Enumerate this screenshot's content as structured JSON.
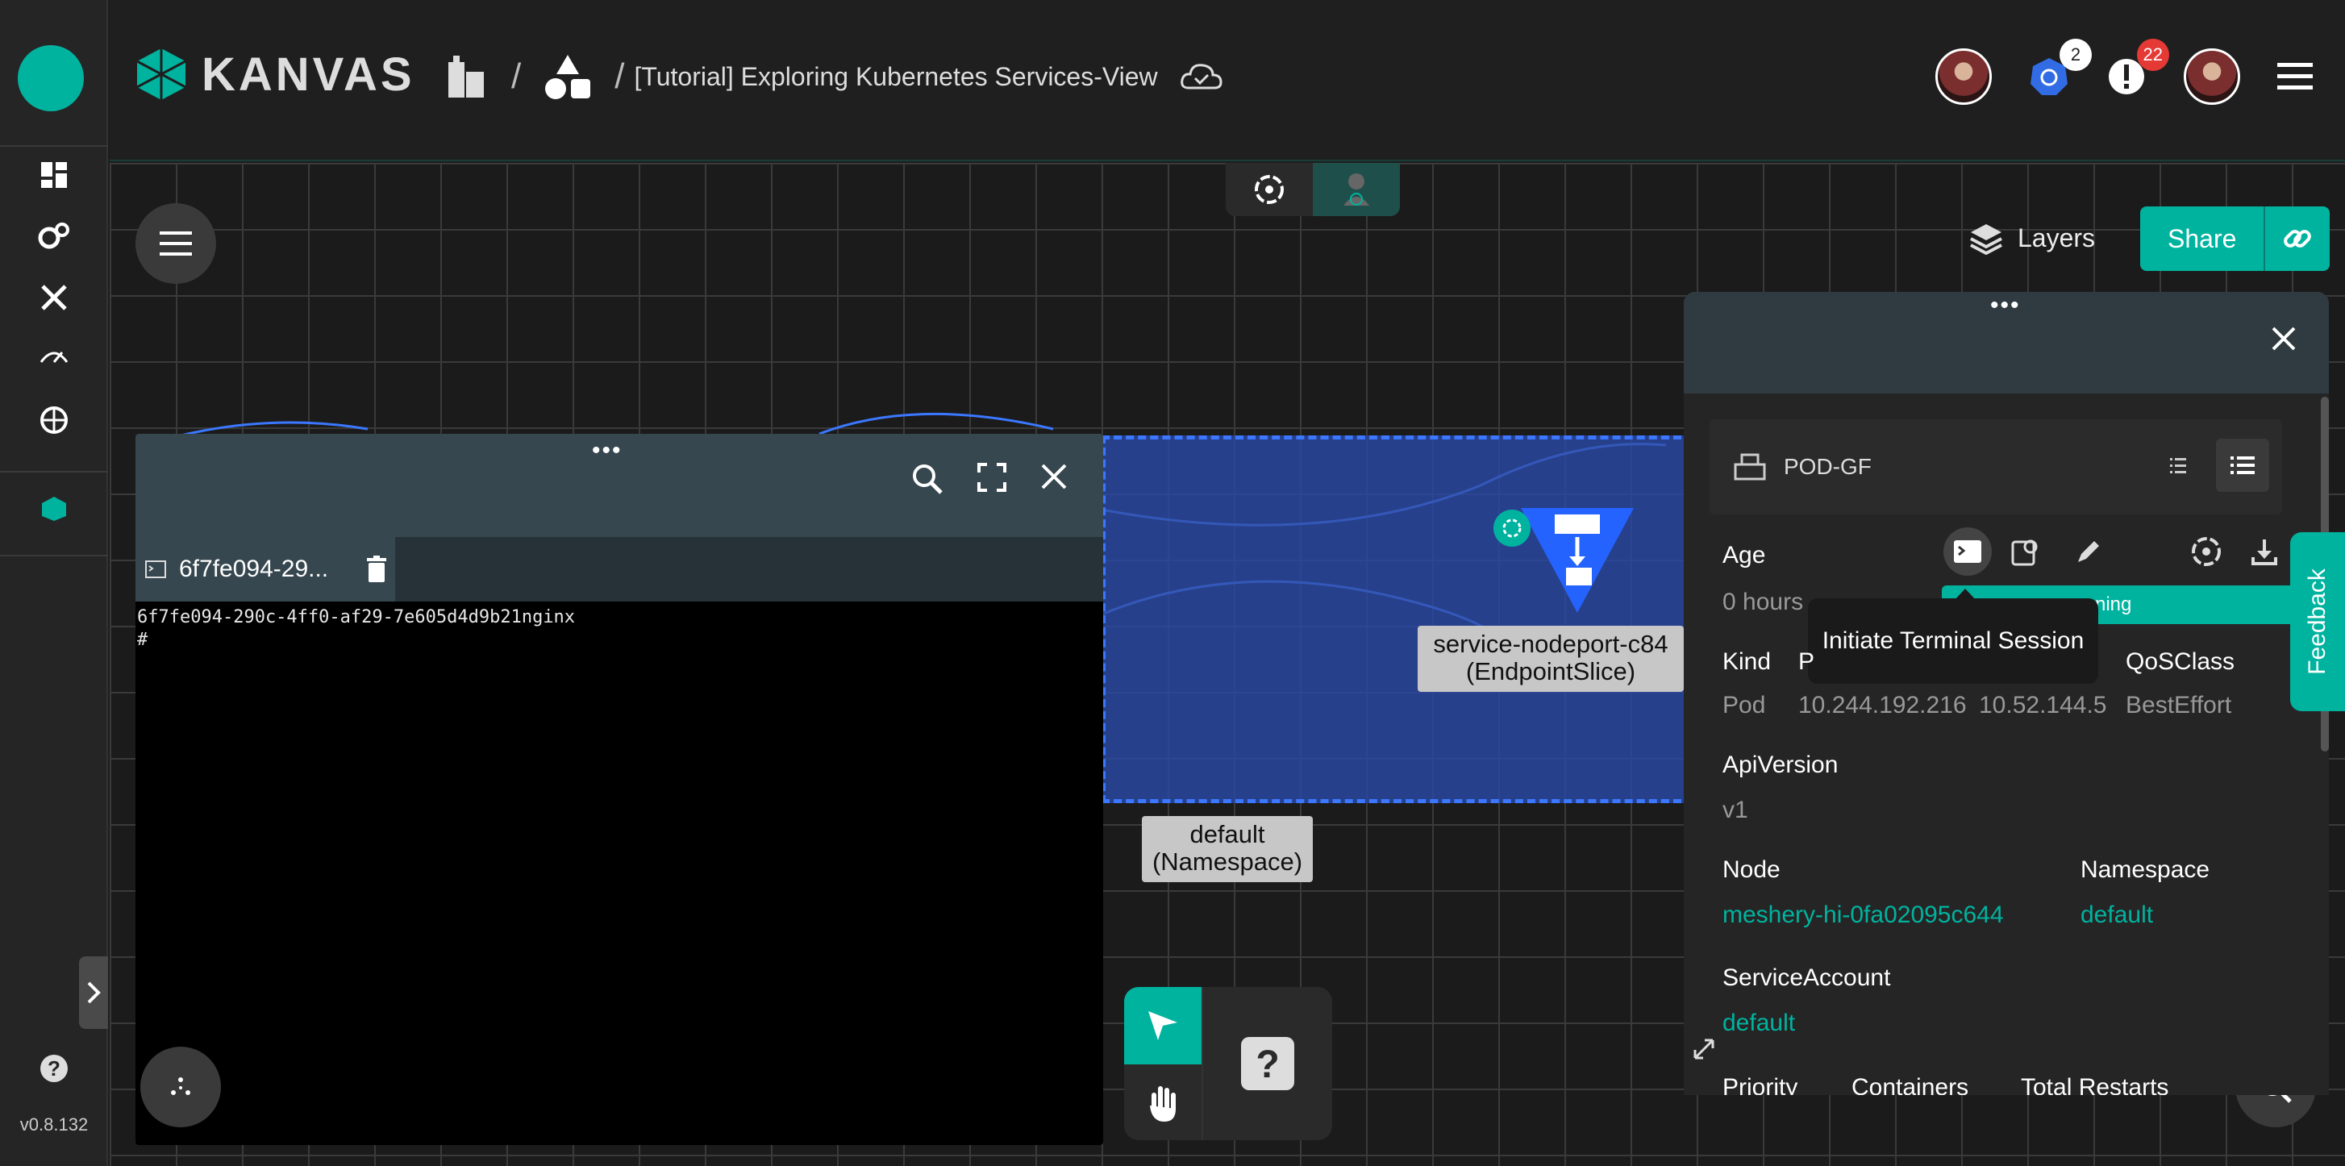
{
  "app": {
    "brand": "KANVAS",
    "version": "v0.8.132"
  },
  "header": {
    "breadcrumb_sep": "/",
    "design_title": "[Tutorial] Exploring Kubernetes Services-View",
    "k8s_badge": "2",
    "alerts_badge": "22"
  },
  "canvas": {
    "layers_label": "Layers",
    "share_label": "Share",
    "node_label_line1": "service-nodeport-c84",
    "node_label_line2": "(EndpointSlice)",
    "namespace_label_line1": "default",
    "namespace_label_line2": "(Namespace)"
  },
  "terminal": {
    "tab_label": "6f7fe094-29...",
    "line1": "6f7fe094-290c-4ff0-af29-7e605d4d9b21nginx",
    "line2": "#"
  },
  "details": {
    "resource_name": "POD-GF",
    "tooltip": "Initiate Terminal Session",
    "status_text": "ning",
    "age_label": "Age",
    "age_value": "0 hours",
    "kind_label": "Kind",
    "p_label": "P",
    "qos_label": "QoSClass",
    "kind_value": "Pod",
    "ip1": "10.244.192.216",
    "ip2": "10.52.144.5",
    "qos_value": "BestEffort",
    "apiversion_label": "ApiVersion",
    "apiversion_value": "v1",
    "node_label": "Node",
    "node_value": "meshery-hi-0fa02095c644",
    "namespace_label": "Namespace",
    "namespace_value": "default",
    "sa_label": "ServiceAccount",
    "sa_value": "default",
    "priority_label": "Priority",
    "containers_label": "Containers",
    "restarts_label": "Total Restarts"
  },
  "feedback_label": "Feedback",
  "colors": {
    "accent": "#00b39f",
    "namespace_fill": "#2a4aa8",
    "badge_k8s": "#ffffff",
    "badge_alert": "#e53935"
  }
}
